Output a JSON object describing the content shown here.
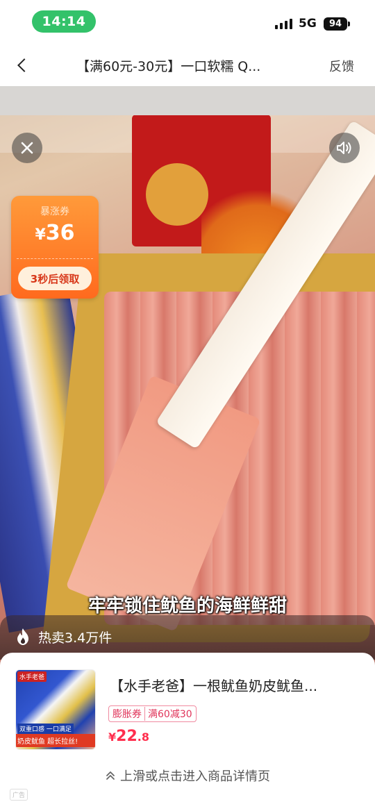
{
  "status_bar": {
    "time": "14:14",
    "network": "5G",
    "battery": "94"
  },
  "nav": {
    "title": "【满60元-30元】一口软糯 Q...",
    "feedback_label": "反馈"
  },
  "coupon": {
    "label": "暴涨券",
    "currency": "¥",
    "amount": "36",
    "button_label": "3秒后领取"
  },
  "video": {
    "subtitle": "牢牢锁住鱿鱼的海鲜鲜甜"
  },
  "hot_sale": {
    "text": "热卖3.4万件"
  },
  "product": {
    "title": "【水手老爸】一根鱿鱼奶皮鱿鱼...",
    "promo_tag": "膨胀券",
    "promo_value": "满60减30",
    "price_symbol": "¥",
    "price_int": "22",
    "price_dec": ".8",
    "thumb_brand": "水手老爸",
    "thumb_badge": "双重口感 一口满足",
    "thumb_banner": "奶皮鱿鱼  超长拉丝!"
  },
  "footer": {
    "swipe_hint": "上滑或点击进入商品详情页",
    "ad_label": "广告"
  },
  "colors": {
    "time_pill": "#33c26a",
    "coupon_orange": "#ff6a1e",
    "price_red": "#ff2e4d",
    "promo_pink": "#e0345a"
  }
}
